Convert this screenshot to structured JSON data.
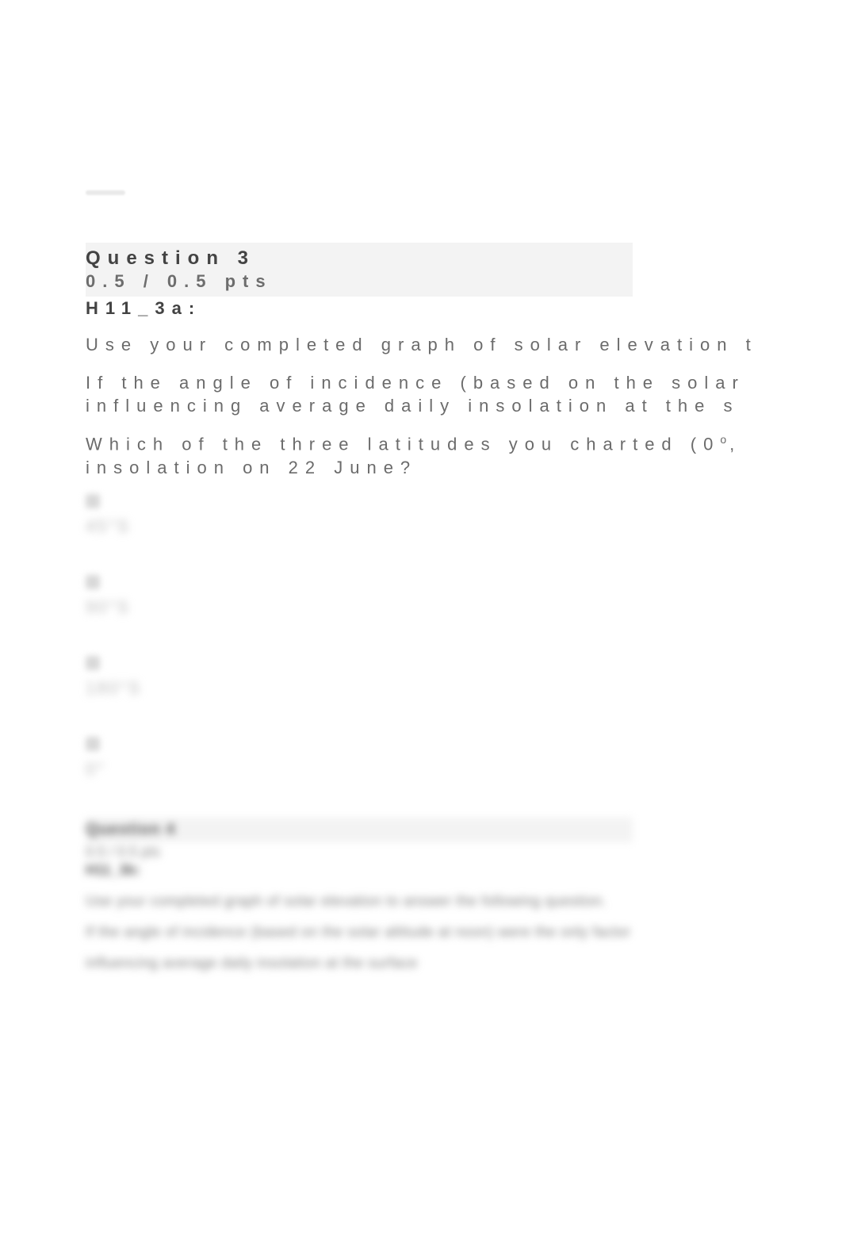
{
  "question3": {
    "header_title": "Question 3",
    "points": "0.5 / 0.5 pts",
    "code": "H11_3a:",
    "line1": "Use your completed graph of solar elevation t",
    "line2a": "If the angle of incidence (based on the solar",
    "line2b": "influencing average daily insolation at the s",
    "line3a_prefix": "Which of the three latitudes you charted (0",
    "line3a_sup": "o",
    "line3a_suffix": ",",
    "line3b": "insolation on 22 June?",
    "options": [
      "45°S",
      "90°S",
      "180°S",
      "0°"
    ]
  },
  "question4_blurred": {
    "header_title": "Question 4",
    "points": "0.5 / 0.5 pts",
    "code": "H11_3b:",
    "line1": "Use your completed graph of solar elevation to answer the following question.",
    "line2": "If the angle of incidence (based on the solar altitude at noon) were the only factor",
    "line3": "influencing average daily insolation at the surface"
  }
}
